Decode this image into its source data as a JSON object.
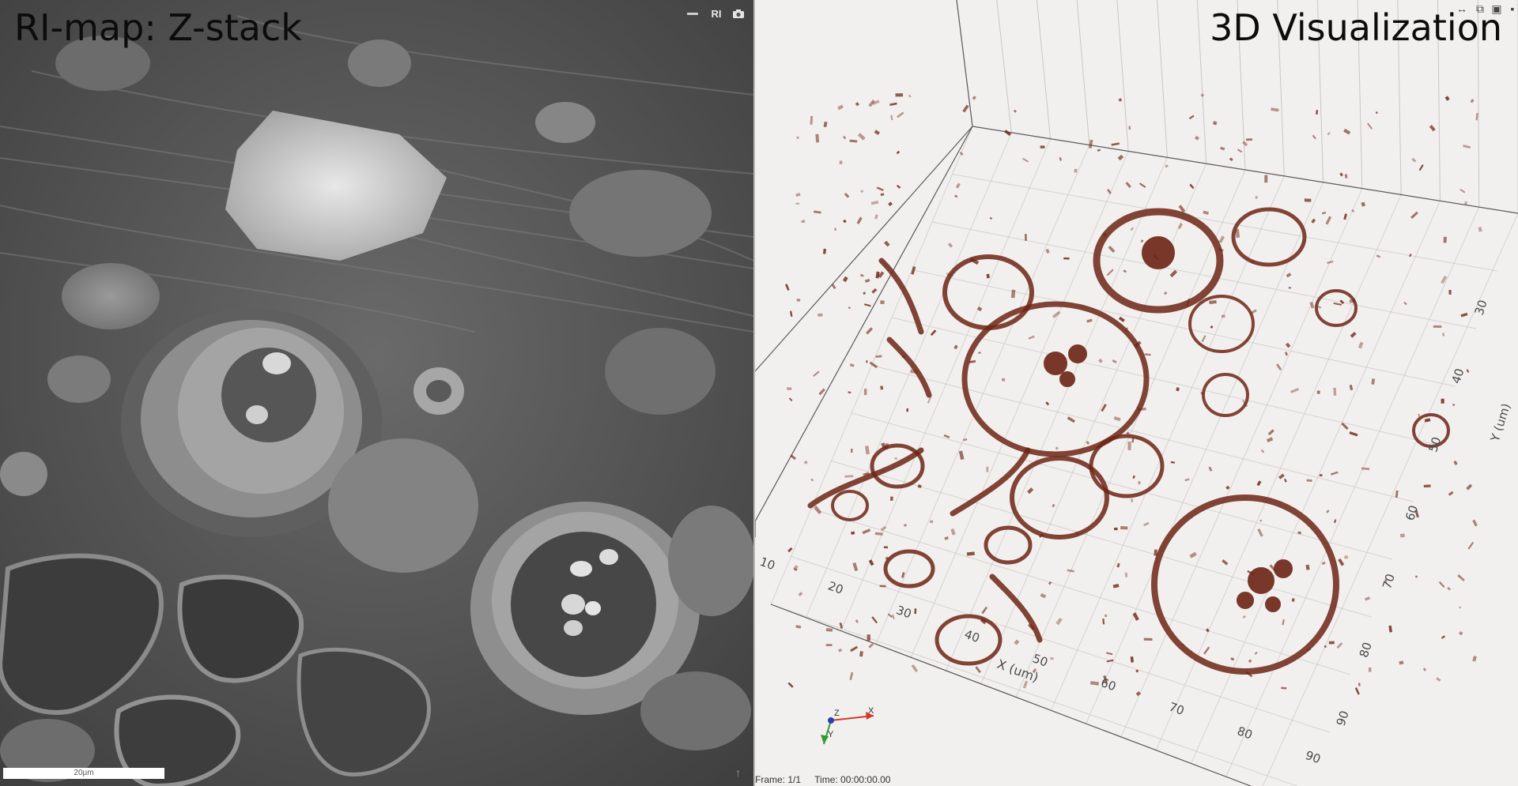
{
  "left_panel": {
    "title": "RI-map: Z-stack",
    "toolbar": {
      "ri_label": "RI",
      "minimize_icon": "minimize-icon",
      "camera_icon": "camera-icon"
    },
    "scale_bar": {
      "label": "20µm"
    },
    "corner_arrow": "↑"
  },
  "right_panel": {
    "title": "3D Visualization",
    "toolbar": {
      "resize_icon": "↔",
      "popout_icon": "⧉",
      "snapshot_icon": "▣",
      "more_icon": "▪"
    },
    "x_axis": {
      "label": "X (um)",
      "ticks": [
        "10",
        "20",
        "30",
        "40",
        "50",
        "60",
        "70",
        "80",
        "90"
      ]
    },
    "y_axis": {
      "label": "Y (um)",
      "ticks": [
        "30",
        "40",
        "50",
        "60",
        "70",
        "80",
        "90"
      ]
    },
    "orientation": {
      "x": "X",
      "y": "Y",
      "z": "Z",
      "colors": {
        "x": "#d23a2a",
        "y": "#2f9a35",
        "z": "#2a3fb4"
      }
    },
    "frame_info": {
      "frame": "Frame: 1/1",
      "time": "Time: 00:00:00.00"
    },
    "stain_color": "#6d2414"
  }
}
